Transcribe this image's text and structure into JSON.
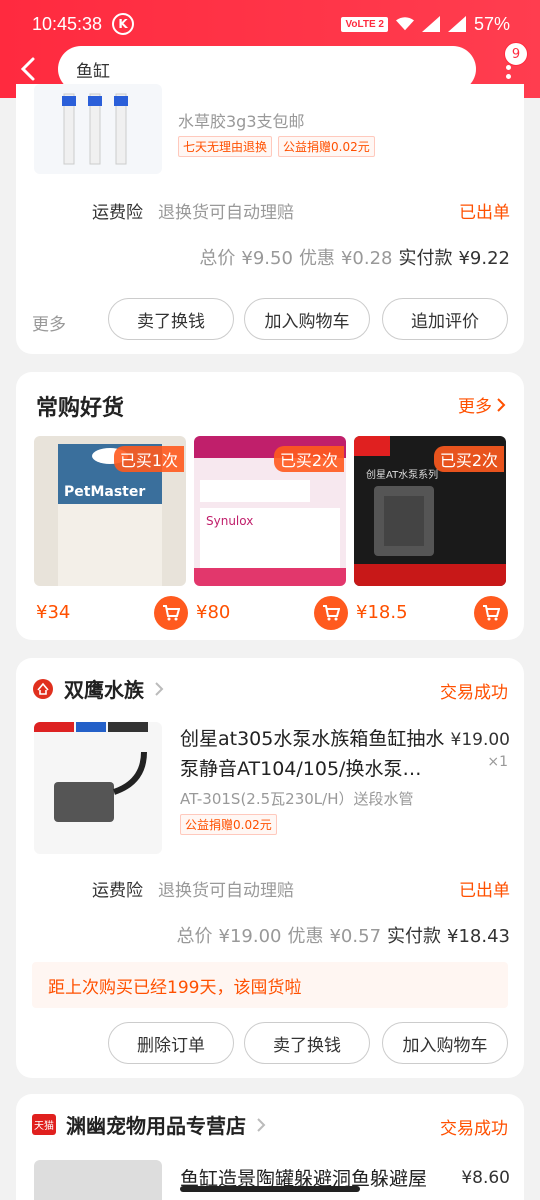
{
  "status": {
    "time": "10:45:38",
    "k": "K",
    "volte": "VoLTE 2",
    "battery": "57%"
  },
  "search": {
    "query": "鱼缸",
    "badge": "9"
  },
  "order1": {
    "title_partial": "水草胶3g3支包邮",
    "tags": [
      "七天无理由退换",
      "公益捐赠0.02元"
    ],
    "insurance": "运费险",
    "insurance_desc": "退换货可自动理赔",
    "insurance_status": "已出单",
    "total_label": "总价",
    "total_value": "¥9.50",
    "discount_label": "优惠",
    "discount_value": "¥0.28",
    "paid_label": "实付款",
    "paid_value": "¥9.22",
    "more": "更多",
    "buttons": [
      "卖了换钱",
      "加入购物车",
      "追加评价"
    ]
  },
  "frequent": {
    "title": "常购好货",
    "more": "更多",
    "items": [
      {
        "tag": "已买1次",
        "price": "¥34",
        "label": "PetMaster"
      },
      {
        "tag": "已买2次",
        "price": "¥80",
        "label": "Synulox"
      },
      {
        "tag": "已买2次",
        "price": "¥18.5",
        "label": "创星AT水泵系列"
      }
    ]
  },
  "order2": {
    "shop": "双鹰水族",
    "status": "交易成功",
    "product_title": "创星at305水泵水族箱鱼缸抽水泵静音AT104/105/换水泵…",
    "spec": "AT-301S(2.5瓦230L/H）送段水管",
    "tag": "公益捐赠0.02元",
    "price": "¥19.00",
    "qty": "×1",
    "insurance": "运费险",
    "insurance_desc": "退换货可自动理赔",
    "insurance_status": "已出单",
    "total_label": "总价",
    "total_value": "¥19.00",
    "discount_label": "优惠",
    "discount_value": "¥0.57",
    "paid_label": "实付款",
    "paid_value": "¥18.43",
    "reminder": "距上次购买已经199天，该囤货啦",
    "buttons": [
      "删除订单",
      "卖了换钱",
      "加入购物车"
    ]
  },
  "order3": {
    "shop_icon": "天猫",
    "shop": "渊幽宠物用品专营店",
    "status": "交易成功",
    "product_title_partial": "鱼缸造景陶罐躲避洞鱼躲避屋",
    "price_partial": "¥8.60"
  }
}
